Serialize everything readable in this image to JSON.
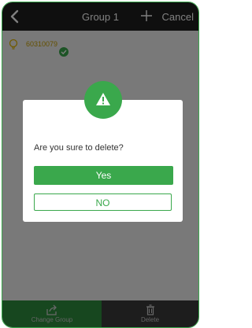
{
  "header": {
    "title": "Group 1",
    "cancel_label": "Cancel",
    "back_icon": "chevron-left-icon",
    "add_icon": "plus-icon"
  },
  "device": {
    "name": "60310079",
    "icon": "bulb-icon",
    "selected_icon": "check-circle-icon"
  },
  "bottom_bar": {
    "change_group_label": "Change Group",
    "delete_label": "Delete"
  },
  "dialog": {
    "icon": "warning-icon",
    "message": "Are you sure to delete?",
    "yes_label": "Yes",
    "no_label": "NO"
  },
  "colors": {
    "accent": "#3aa84c",
    "header_bg": "#1f1f1f",
    "device_text": "#c9a100"
  }
}
